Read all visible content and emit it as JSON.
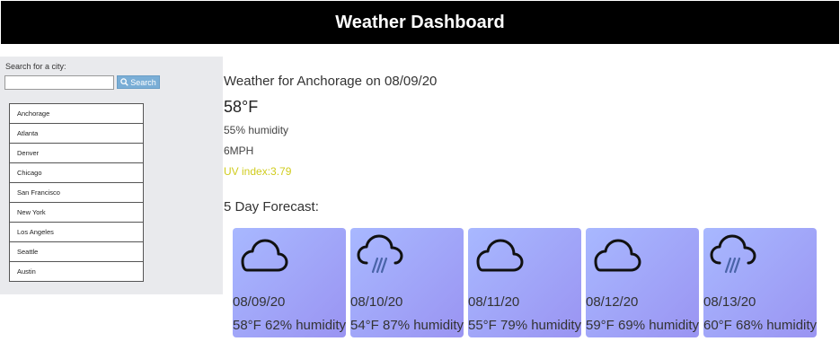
{
  "header": {
    "title": "Weather Dashboard"
  },
  "sidebar": {
    "search_label": "Search for a city:",
    "search_value": "",
    "search_button": "Search",
    "cities": [
      "Anchorage",
      "Atlanta",
      "Denver",
      "Chicago",
      "San Francisco",
      "New York",
      "Los Angeles",
      "Seattle",
      "Austin"
    ]
  },
  "current": {
    "title": "Weather for Anchorage on 08/09/20",
    "temp": "58°F",
    "humidity": "55% humidity",
    "wind": "6MPH",
    "uv": "UV index:3.79"
  },
  "forecast": {
    "title": "5 Day Forecast:",
    "days": [
      {
        "date": "08/09/20",
        "stats": "58°F 62% humidity",
        "icon": "cloud-icon"
      },
      {
        "date": "08/10/20",
        "stats": "54°F 87% humidity",
        "icon": "rain-cloud-icon"
      },
      {
        "date": "08/11/20",
        "stats": "55°F 79% humidity",
        "icon": "cloud-icon"
      },
      {
        "date": "08/12/20",
        "stats": "59°F 69% humidity",
        "icon": "cloud-icon"
      },
      {
        "date": "08/13/20",
        "stats": "60°F 68% humidity",
        "icon": "rain-cloud-icon"
      }
    ]
  },
  "colors": {
    "header_bg": "#000000",
    "uv_text": "#d0cc1e",
    "search_button": "#7aaed6",
    "card_gradient_start": "#a8b8ff",
    "card_gradient_end": "#9a94f2"
  }
}
